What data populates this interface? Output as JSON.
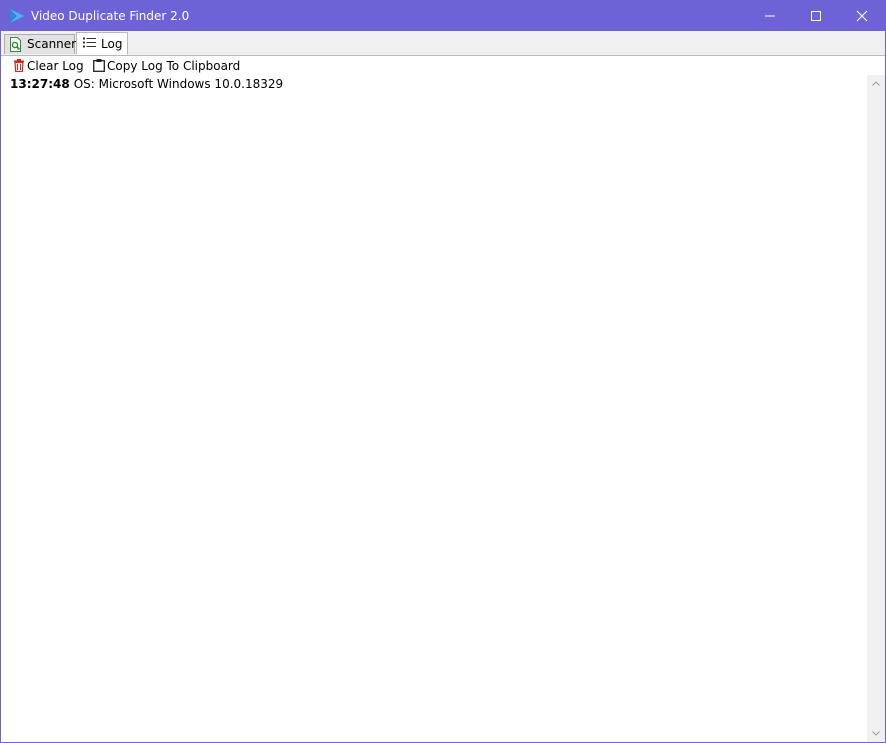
{
  "window": {
    "title": "Video Duplicate Finder 2.0",
    "accent_color": "#6e63d6",
    "controls": {
      "minimize_icon": "minimize-icon",
      "maximize_icon": "maximize-icon",
      "close_icon": "close-icon"
    }
  },
  "tabs": [
    {
      "label": "Scanner",
      "icon": "scanner-icon",
      "selected": false
    },
    {
      "label": "Log",
      "icon": "list-icon",
      "selected": true
    }
  ],
  "toolbar": {
    "clear_label": "Clear Log",
    "clear_icon": "trash-icon",
    "copy_label": "Copy Log To Clipboard",
    "copy_icon": "clipboard-icon"
  },
  "log": {
    "entries": [
      {
        "time": "13:27:48",
        "message": "OS: Microsoft Windows 10.0.18329"
      }
    ]
  }
}
